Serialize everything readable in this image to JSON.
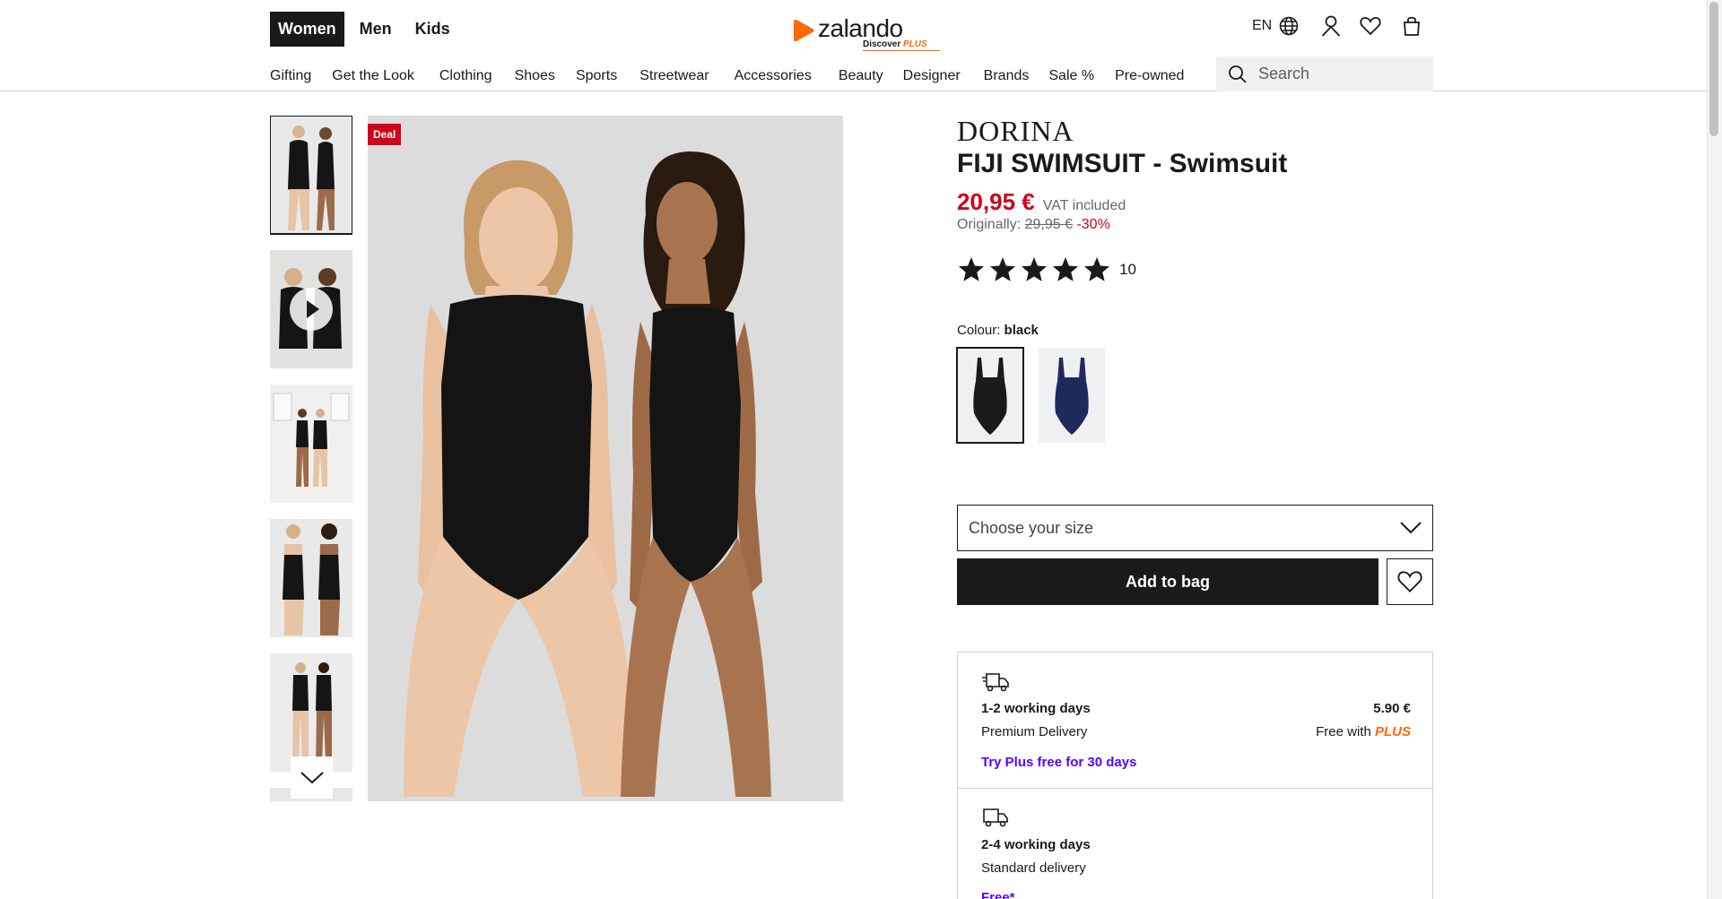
{
  "header": {
    "gender_tabs": [
      "Women",
      "Men",
      "Kids"
    ],
    "logo_text": "zalando",
    "logo_sub": "Discover",
    "logo_sub_plus": "PLUS",
    "lang": "EN",
    "nav": [
      "Gifting",
      "Get the Look",
      "Clothing",
      "Shoes",
      "Sports",
      "Streetwear",
      "Accessories",
      "Beauty",
      "Designer",
      "Brands",
      "Sale %",
      "Pre-owned"
    ],
    "search_placeholder": "Search"
  },
  "gallery": {
    "badge": "Deal",
    "thumbnail_count": 6,
    "selected_index": 0
  },
  "product": {
    "brand": "DORINA",
    "name": "FIJI SWIMSUIT - Swimsuit",
    "price": "20,95 €",
    "vat": "VAT included",
    "orig_label": "Originally:",
    "orig_price": "29,95 €",
    "discount": "-30%",
    "rating": 5,
    "review_count": "10",
    "colour_label": "Colour:",
    "colour_value": "black",
    "colours": [
      {
        "name": "black",
        "hex": "#1a1a1a"
      },
      {
        "name": "navy",
        "hex": "#1f2a5c"
      }
    ],
    "size_placeholder": "Choose your size",
    "add_to_bag": "Add to bag"
  },
  "delivery": {
    "options": [
      {
        "days": "1-2 working days",
        "type": "Premium Delivery",
        "cost": "5.90 €",
        "free_with": "Free with",
        "free_with_plus": "PLUS",
        "link": "Try Plus free for 30 days"
      },
      {
        "days": "2-4 working days",
        "type": "Standard delivery",
        "cost_note": "Free*"
      }
    ]
  },
  "colors": {
    "accent_orange": "#ff6900",
    "price_red": "#d0021b",
    "link_purple": "#5a00ff",
    "dark": "#1a1a1a"
  }
}
